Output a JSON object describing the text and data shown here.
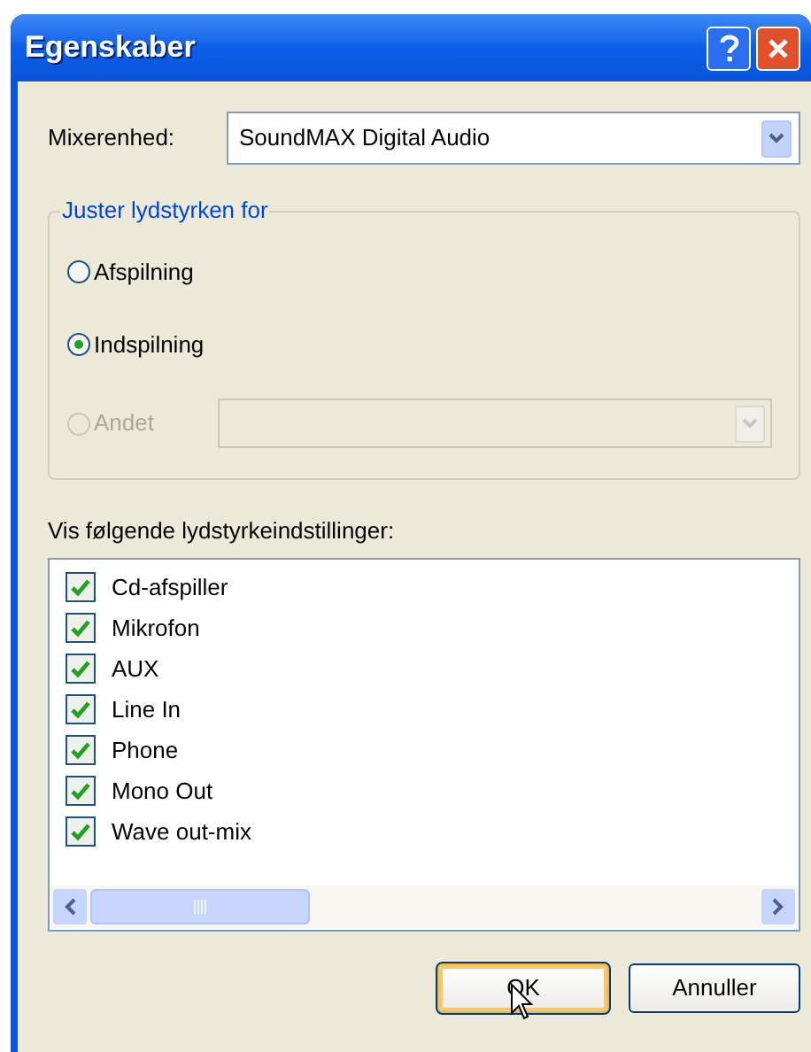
{
  "window": {
    "title": "Egenskaber"
  },
  "mixer": {
    "label": "Mixerenhed:",
    "value": "SoundMAX Digital Audio"
  },
  "volume_group": {
    "legend": "Juster lydstyrken for",
    "options": [
      {
        "label": "Afspilning",
        "selected": false,
        "disabled": false
      },
      {
        "label": "Indspilning",
        "selected": true,
        "disabled": false
      },
      {
        "label": "Andet",
        "selected": false,
        "disabled": true,
        "kind": "with-dropdown"
      }
    ]
  },
  "controls_list": {
    "label": "Vis følgende lydstyrkeindstillinger:",
    "items": [
      {
        "label": "Cd-afspiller",
        "checked": true
      },
      {
        "label": "Mikrofon",
        "checked": true
      },
      {
        "label": "AUX",
        "checked": true
      },
      {
        "label": "Line In",
        "checked": true
      },
      {
        "label": "Phone",
        "checked": true
      },
      {
        "label": "Mono Out",
        "checked": true
      },
      {
        "label": "Wave out-mix",
        "checked": true
      }
    ]
  },
  "buttons": [
    {
      "label": "OK",
      "focused": true
    },
    {
      "label": "Annuller",
      "focused": false
    }
  ]
}
